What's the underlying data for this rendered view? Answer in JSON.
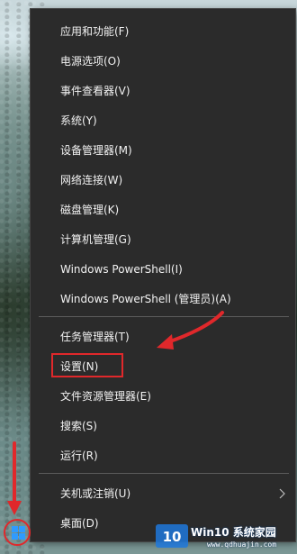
{
  "menu": {
    "items": [
      {
        "label": "应用和功能(F)"
      },
      {
        "label": "电源选项(O)"
      },
      {
        "label": "事件查看器(V)"
      },
      {
        "label": "系统(Y)"
      },
      {
        "label": "设备管理器(M)"
      },
      {
        "label": "网络连接(W)"
      },
      {
        "label": "磁盘管理(K)"
      },
      {
        "label": "计算机管理(G)"
      },
      {
        "label": "Windows PowerShell(I)"
      },
      {
        "label": "Windows PowerShell (管理员)(A)"
      },
      {
        "label": "任务管理器(T)"
      },
      {
        "label": "设置(N)"
      },
      {
        "label": "文件资源管理器(E)"
      },
      {
        "label": "搜索(S)"
      },
      {
        "label": "运行(R)"
      },
      {
        "label": "关机或注销(U)"
      },
      {
        "label": "桌面(D)"
      }
    ]
  },
  "watermark": {
    "logo_text": "Win10 系统家园",
    "url": "www.qdhuajin.com",
    "icon_text": "10"
  },
  "colors": {
    "menu_bg": "#2b2b2b",
    "menu_text": "#f2f2f2",
    "separator": "#5c5c5c",
    "annotation_red": "#e0282b",
    "start_icon": "#1e90ff"
  }
}
